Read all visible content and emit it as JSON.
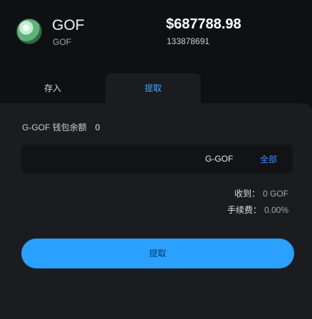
{
  "asset": {
    "logo_icon": "gof-coin-logo-icon",
    "symbol": "GOF",
    "sub_symbol": "GOF",
    "price": "$687788.98",
    "price_sub": "133878691"
  },
  "tabs": [
    {
      "label": "存入",
      "active": false
    },
    {
      "label": "提取",
      "active": true
    }
  ],
  "withdraw": {
    "balance_label": "G-GOF 钱包余额",
    "balance_value": "0",
    "amount_value": "",
    "amount_unit": "G-GOF",
    "all_label": "全部",
    "receive_label": "收到：",
    "receive_value": "0 GOF",
    "fee_label": "手续费：",
    "fee_value": "0.00%",
    "submit_label": "提取"
  },
  "colors": {
    "accent": "#2aa0ff",
    "active_tab": "#40a6ff",
    "panel": "#1b1c1f",
    "background": "#0f1012"
  }
}
